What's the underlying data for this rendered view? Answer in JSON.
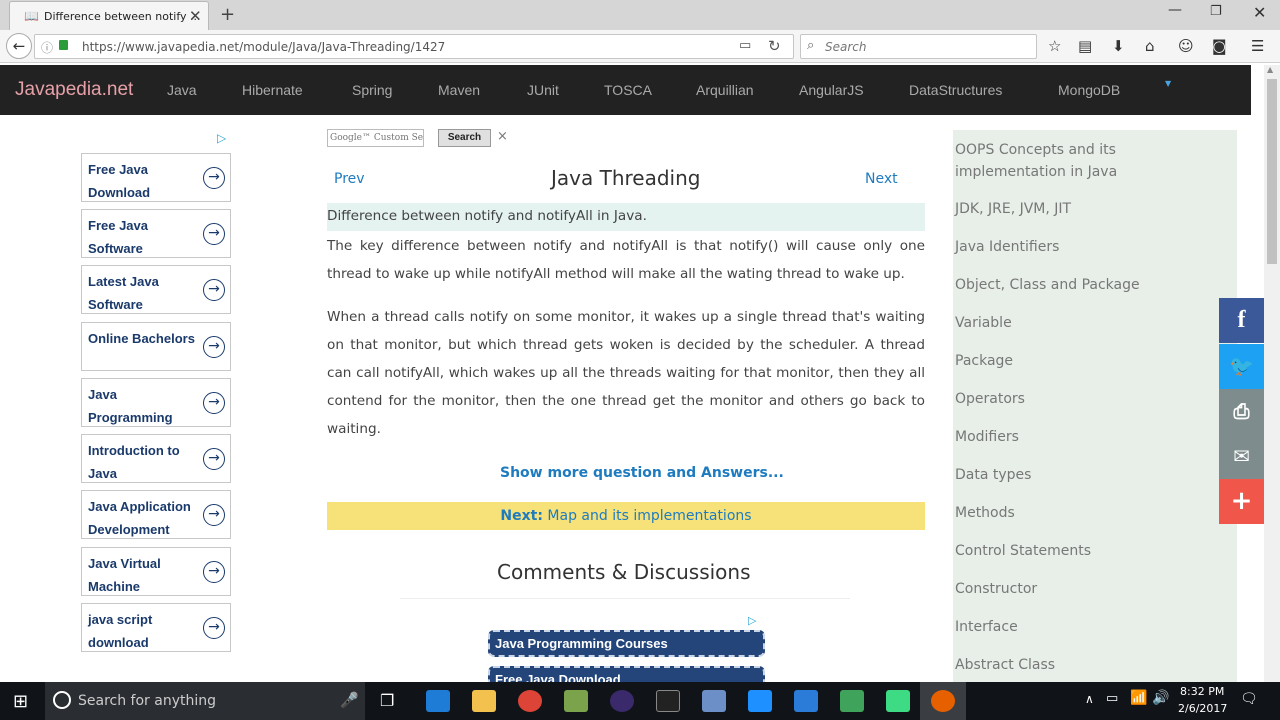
{
  "browser": {
    "tab_title": "Difference between notify ...",
    "url": "https://www.javapedia.net/module/Java/Java-Threading/1427",
    "search_placeholder": "Search"
  },
  "site": {
    "logo": "Javapedia.net",
    "nav": [
      "Java",
      "Hibernate",
      "Spring",
      "Maven",
      "JUnit",
      "TOSCA",
      "Arquillian",
      "AngularJS",
      "DataStructures",
      "MongoDB"
    ]
  },
  "ads_left": [
    "Free Java Download",
    "Free Java Software",
    "Latest Java Software",
    "Online Bachelors",
    "Java Programming",
    "Introduction to Java",
    "Java Application Development",
    "Java Virtual Machine",
    "java script download"
  ],
  "google_search": {
    "placeholder": "Google™ Custom Sea",
    "button": "Search",
    "close": "×"
  },
  "article": {
    "prev": "Prev",
    "title": "Java Threading",
    "next": "Next",
    "question": "Difference between notify and notifyAll in Java.",
    "para1": "The key difference between notify and notifyAll is that notify() will cause only one thread to wake up while notifyAll method will make all the wating thread to wake up.",
    "para2": "When a thread calls notify on some monitor, it wakes up a single thread that's waiting on that monitor, but which thread gets woken is decided by the scheduler. A thread can call notifyAll, which wakes up all the threads waiting for that monitor, then they all contend for the monitor, then the one thread get the monitor and others go back to waiting.",
    "show_more": "Show more question and Answers...",
    "next_label": "Next:",
    "next_topic": "Map and its implementations",
    "comments_heading": "Comments & Discussions"
  },
  "ads_bottom": [
    "Java Programming Courses",
    "Free Java Download"
  ],
  "sidebar_right": [
    "OOPS Concepts and its",
    "implementation in Java",
    "JDK, JRE, JVM, JIT",
    "Java Identifiers",
    "Object, Class and Package",
    "Variable",
    "Package",
    "Operators",
    "Modifiers",
    "Data types",
    "Methods",
    "Control Statements",
    "Constructor",
    "Interface",
    "Abstract Class"
  ],
  "taskbar": {
    "search_placeholder": "Search for anything",
    "time": "8:32 PM",
    "date": "2/6/2017"
  },
  "colors": {
    "site_nav_bg": "#222222",
    "logo": "#e6a0a8",
    "question_bg": "#e4f2f0",
    "next_bar_bg": "#f7e27a",
    "link_blue": "#1e7bbf",
    "sidebar_bg": "#e7efe8",
    "facebook": "#3b5998",
    "twitter": "#1da1f2",
    "print": "#7f8c8d",
    "email": "#7f8c8d",
    "share": "#f0574a"
  }
}
